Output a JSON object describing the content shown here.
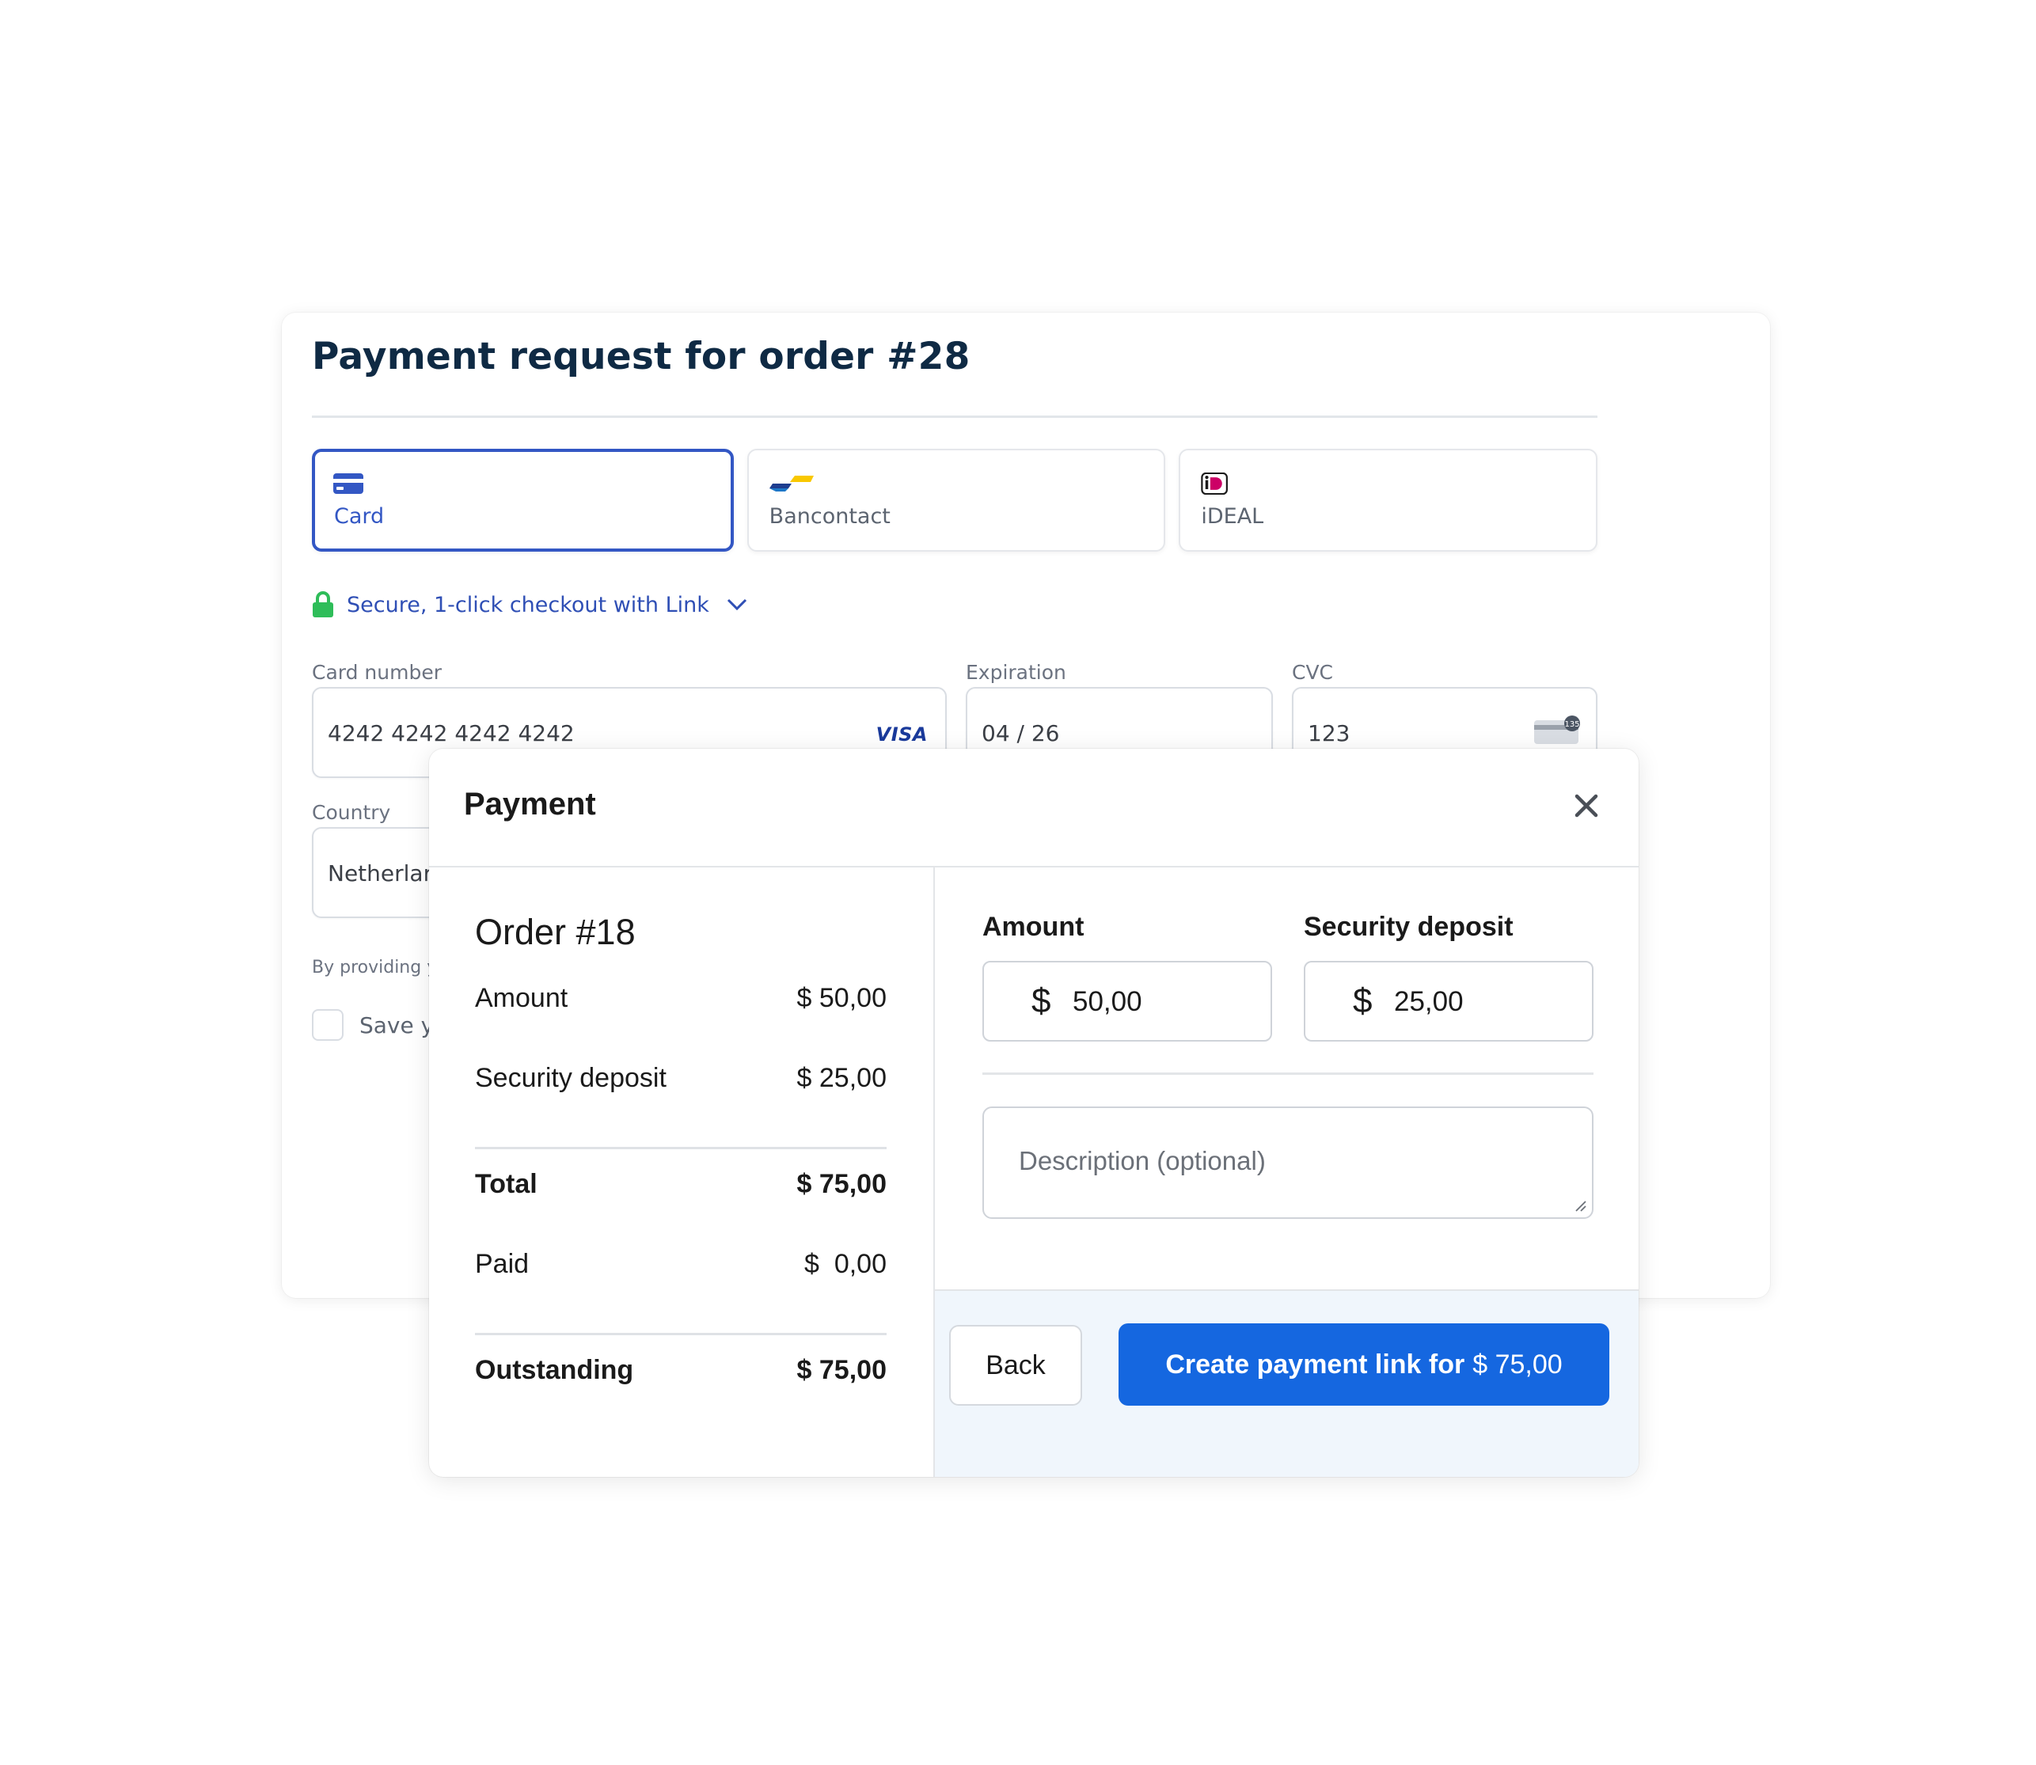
{
  "background_form": {
    "title": "Payment request for order #28",
    "tabs": [
      {
        "label": "Card",
        "icon": "credit-card-icon",
        "active": true
      },
      {
        "label": "Bancontact",
        "icon": "bancontact-logo-icon",
        "active": false
      },
      {
        "label": "iDEAL",
        "icon": "ideal-logo-icon",
        "active": false
      }
    ],
    "link_checkout": "Secure, 1-click checkout with Link",
    "card_number": {
      "label": "Card number",
      "value": "4242 4242 4242 4242",
      "brand": "VISA"
    },
    "expiration": {
      "label": "Expiration",
      "value": "04 / 26"
    },
    "cvc": {
      "label": "CVC",
      "value": "123",
      "icon_badge": "135"
    },
    "country": {
      "label": "Country",
      "value": "Netherlar"
    },
    "fine_print": "By providing y",
    "save_label": "Save yo"
  },
  "modal": {
    "title": "Payment",
    "summary": {
      "order_title": "Order #18",
      "rows": [
        {
          "label": "Amount",
          "value": "$ 50,00",
          "bold": false
        },
        {
          "label": "Security deposit",
          "value": "$ 25,00",
          "bold": false
        },
        {
          "label": "Total",
          "value": "$ 75,00",
          "bold": true
        },
        {
          "label": "Paid",
          "value": "$  0,00",
          "bold": false
        },
        {
          "label": "Outstanding",
          "value": "$ 75,00",
          "bold": true
        }
      ]
    },
    "form": {
      "amount_label": "Amount",
      "amount_currency": "$",
      "amount_value": "50,00",
      "deposit_label": "Security deposit",
      "deposit_currency": "$",
      "deposit_value": "25,00",
      "description_placeholder": "Description (optional)"
    },
    "buttons": {
      "back": "Back",
      "create_bold": "Create payment link for",
      "create_amount": "$ 75,00"
    }
  },
  "colors": {
    "accent": "#1567e0",
    "tab_active": "#3357c4",
    "title": "#0f2a44",
    "footer_bg": "#f0f6fc",
    "lock": "#2ebd59"
  }
}
